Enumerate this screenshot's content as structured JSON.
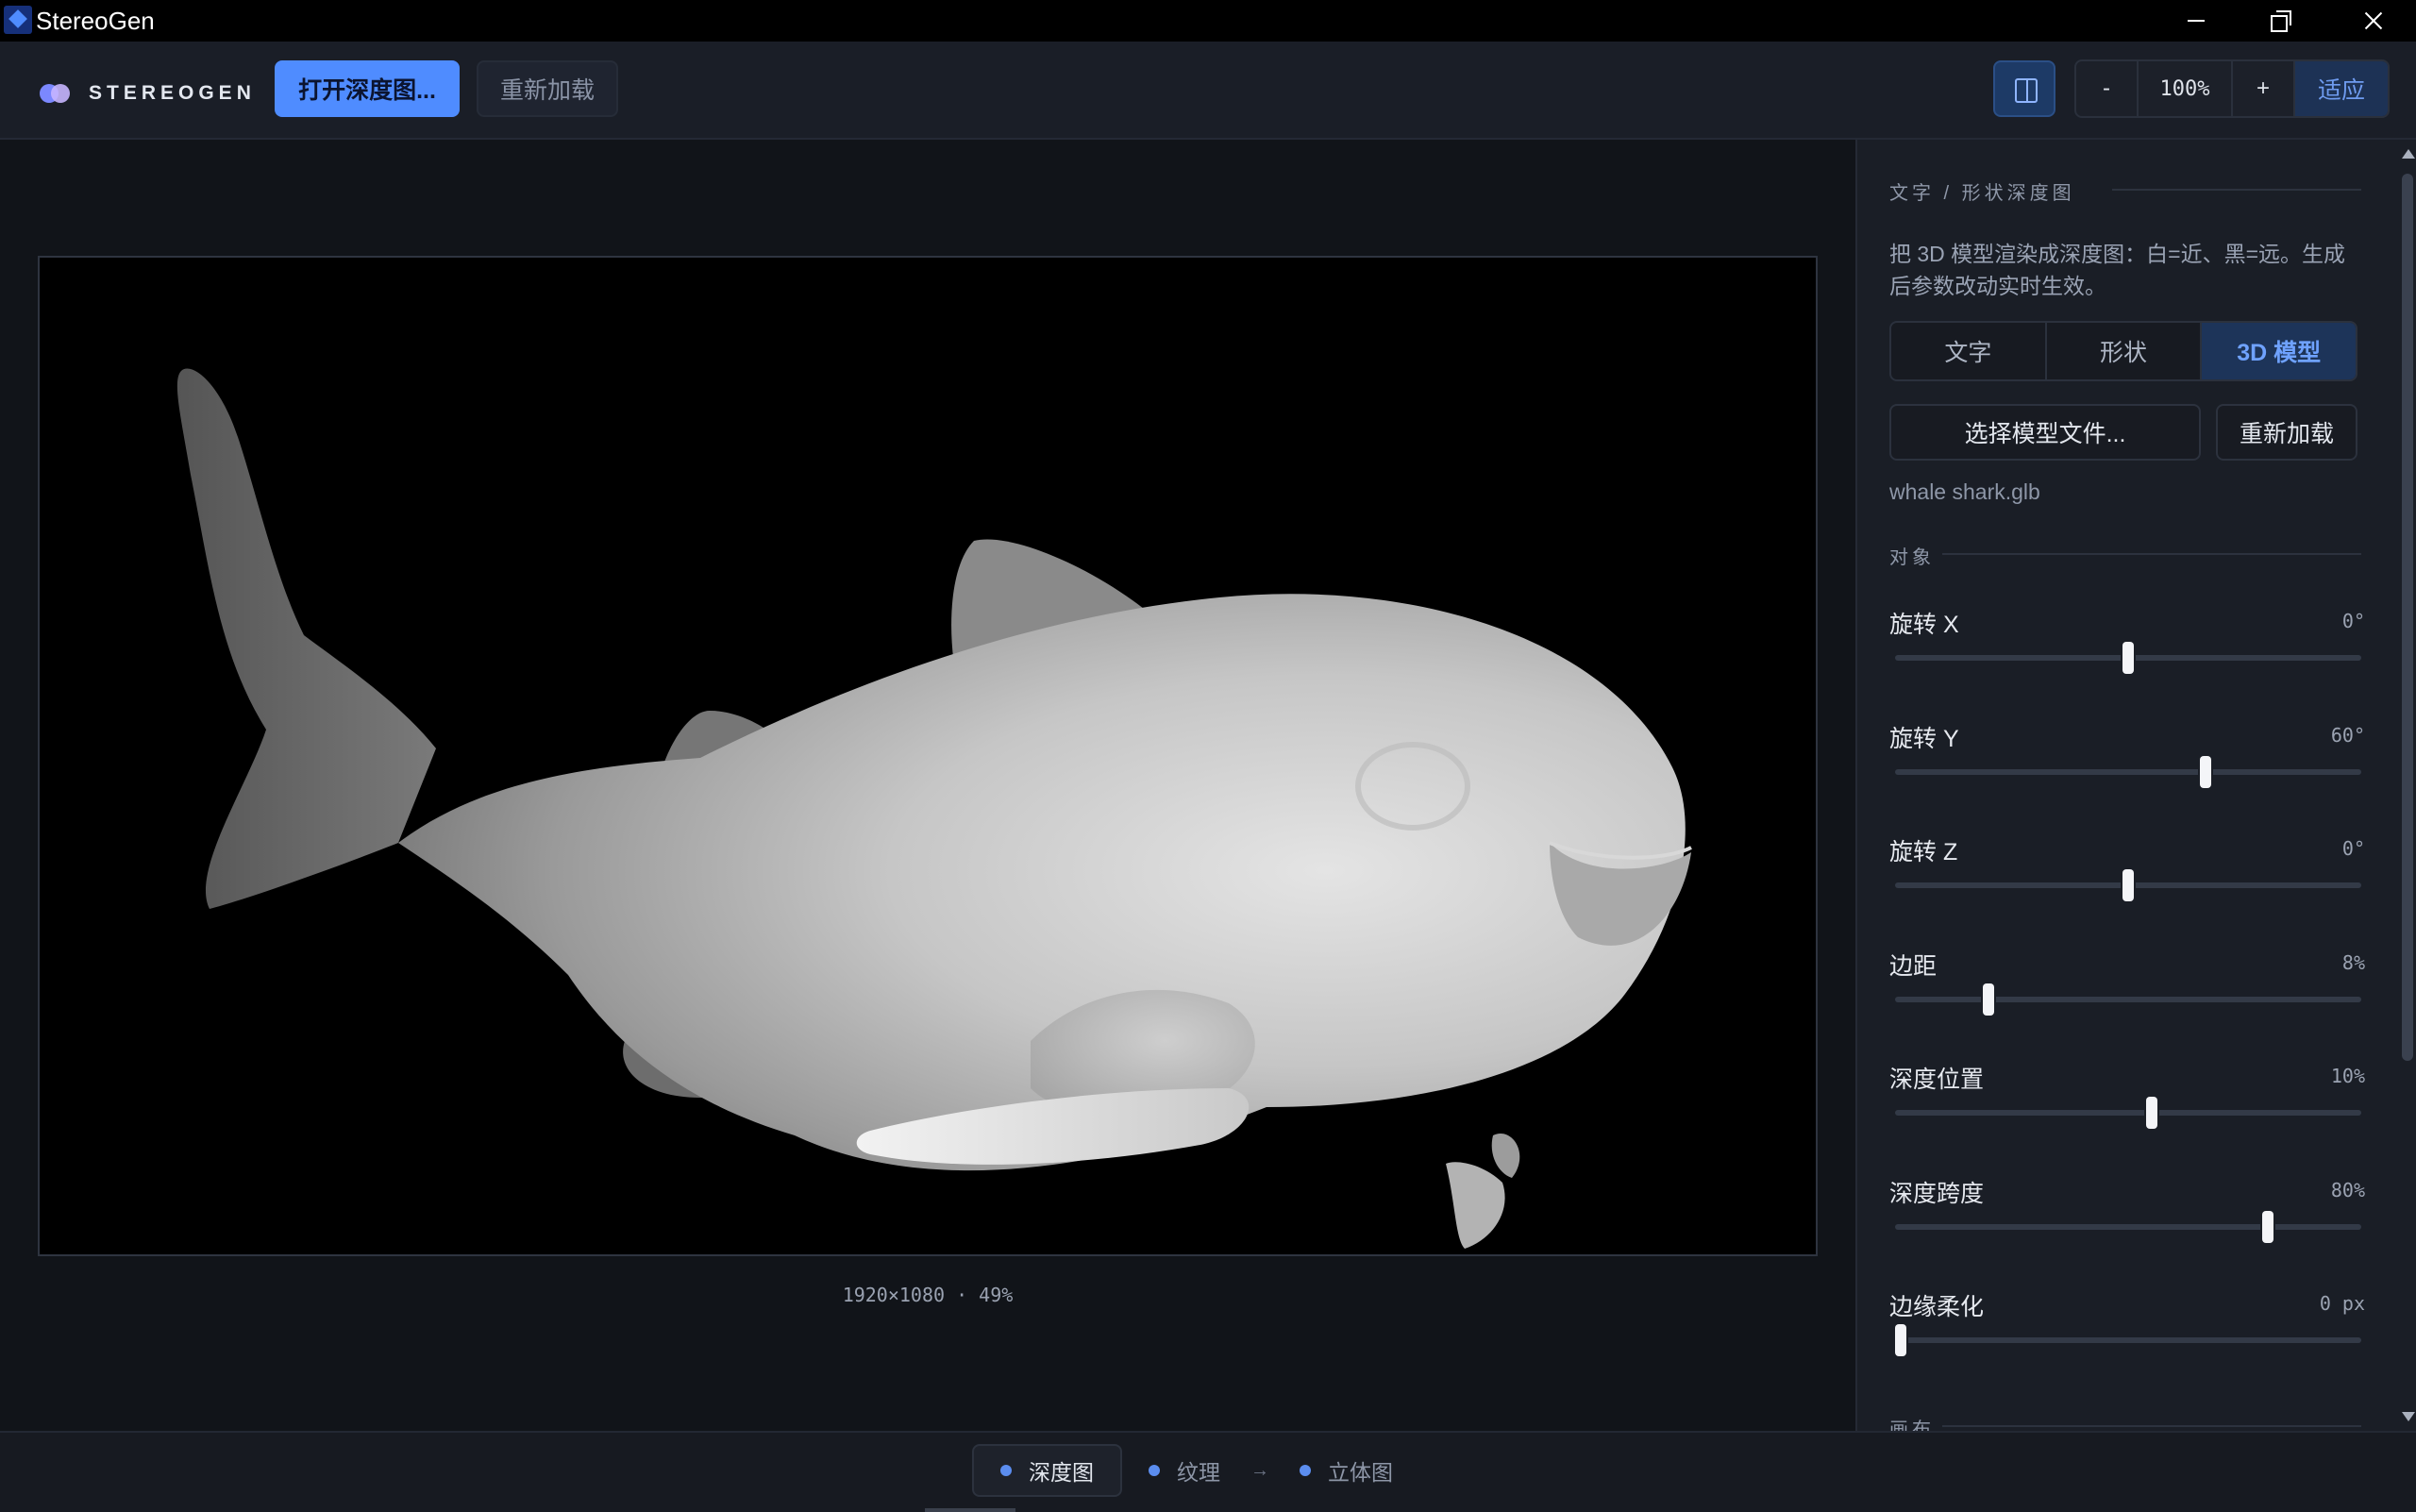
{
  "window": {
    "title": "StereoGen"
  },
  "toolbar": {
    "brand": "STEREOGEN",
    "open_depth_label": "打开深度图...",
    "reload_label": "重新加载",
    "zoom_out_label": "-",
    "zoom_value": "100%",
    "zoom_in_label": "+",
    "fit_label": "适应"
  },
  "canvas": {
    "image_info": "1920×1080 · 49%"
  },
  "panel": {
    "section_title": "文字 / 形状深度图",
    "description": "把 3D 模型渲染成深度图：白=近、黑=远。生成后参数改动实时生效。",
    "tabs": [
      {
        "label": "文字",
        "active": false
      },
      {
        "label": "形状",
        "active": false
      },
      {
        "label": "3D 模型",
        "active": true
      }
    ],
    "select_model_label": "选择模型文件...",
    "reload_model_label": "重新加载",
    "file_name": "whale shark.glb",
    "object_section": "对象",
    "sliders": [
      {
        "label": "旋转 X",
        "value": "0°",
        "fraction": 0.5
      },
      {
        "label": "旋转 Y",
        "value": "60°",
        "fraction": 0.667
      },
      {
        "label": "旋转 Z",
        "value": "0°",
        "fraction": 0.5
      },
      {
        "label": "边距",
        "value": "8%",
        "fraction": 0.2
      },
      {
        "label": "深度位置",
        "value": "10%",
        "fraction": 0.55
      },
      {
        "label": "深度跨度",
        "value": "80%",
        "fraction": 0.8
      },
      {
        "label": "边缘柔化",
        "value": "0 px",
        "fraction": 0.0
      }
    ],
    "next_section": "画布"
  },
  "steps": [
    {
      "label": "深度图",
      "active": true
    },
    {
      "label": "纹理",
      "active": false
    },
    {
      "label": "立体图",
      "active": false
    }
  ],
  "step_arrow": "→",
  "icons": {
    "app": "stereogen-app-icon",
    "panel_toggle": "sidebar-toggle-icon"
  },
  "colors": {
    "accent": "#4f8cff",
    "background": "#13161d",
    "panel": "#1a1e26"
  }
}
